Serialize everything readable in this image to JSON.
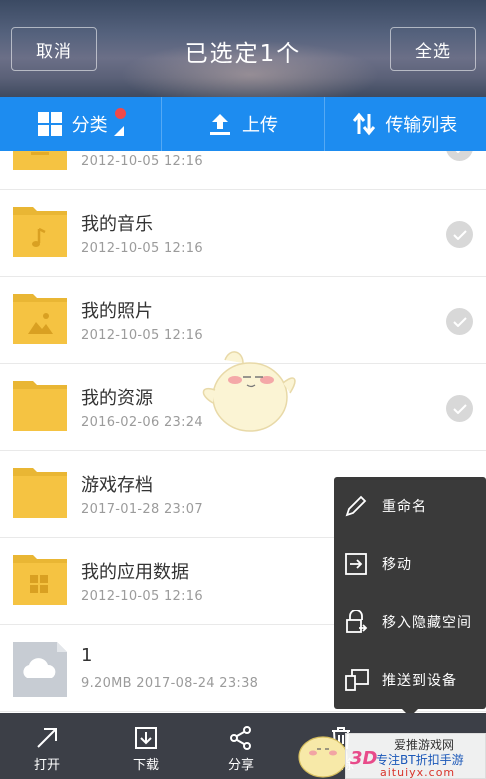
{
  "header": {
    "cancel_label": "取消",
    "title": "已选定1个",
    "select_all_label": "全选"
  },
  "toolbar": {
    "category_label": "分类",
    "upload_label": "上传",
    "transfer_label": "传输列表"
  },
  "files": [
    {
      "name": "",
      "meta": "2012-10-05   12:16",
      "type": "folder",
      "selected": false
    },
    {
      "name": "我的音乐",
      "meta": "2012-10-05   12:16",
      "type": "folder-music",
      "selected": false
    },
    {
      "name": "我的照片",
      "meta": "2012-10-05   12:16",
      "type": "folder-photo",
      "selected": false
    },
    {
      "name": "我的资源",
      "meta": "2016-02-06   23:24",
      "type": "folder",
      "selected": false
    },
    {
      "name": "游戏存档",
      "meta": "2017-01-28   23:07",
      "type": "folder",
      "selected": false
    },
    {
      "name": "我的应用数据",
      "meta": "2012-10-05   12:16",
      "type": "folder-app",
      "selected": false
    },
    {
      "name": "1",
      "meta": "9.20MB    2017-08-24   23:38",
      "type": "cloud-file",
      "selected": true
    }
  ],
  "menu": {
    "rename_label": "重命名",
    "move_label": "移动",
    "move_private_label": "移入隐藏空间",
    "push_device_label": "推送到设备"
  },
  "bottom": {
    "open_label": "打开",
    "download_label": "下载",
    "share_label": "分享",
    "delete_label": "删除"
  },
  "watermark": {
    "line1": "爱推游戏网",
    "line2": "专注BT折扣手游",
    "line3": "aituiyx.com",
    "logo": "3D"
  },
  "colors": {
    "toolbar_blue": "#1d8cf0",
    "folder_yellow": "#f5c342",
    "menu_bg": "#3a3a3a",
    "bottom_bg": "#3c3f47"
  }
}
